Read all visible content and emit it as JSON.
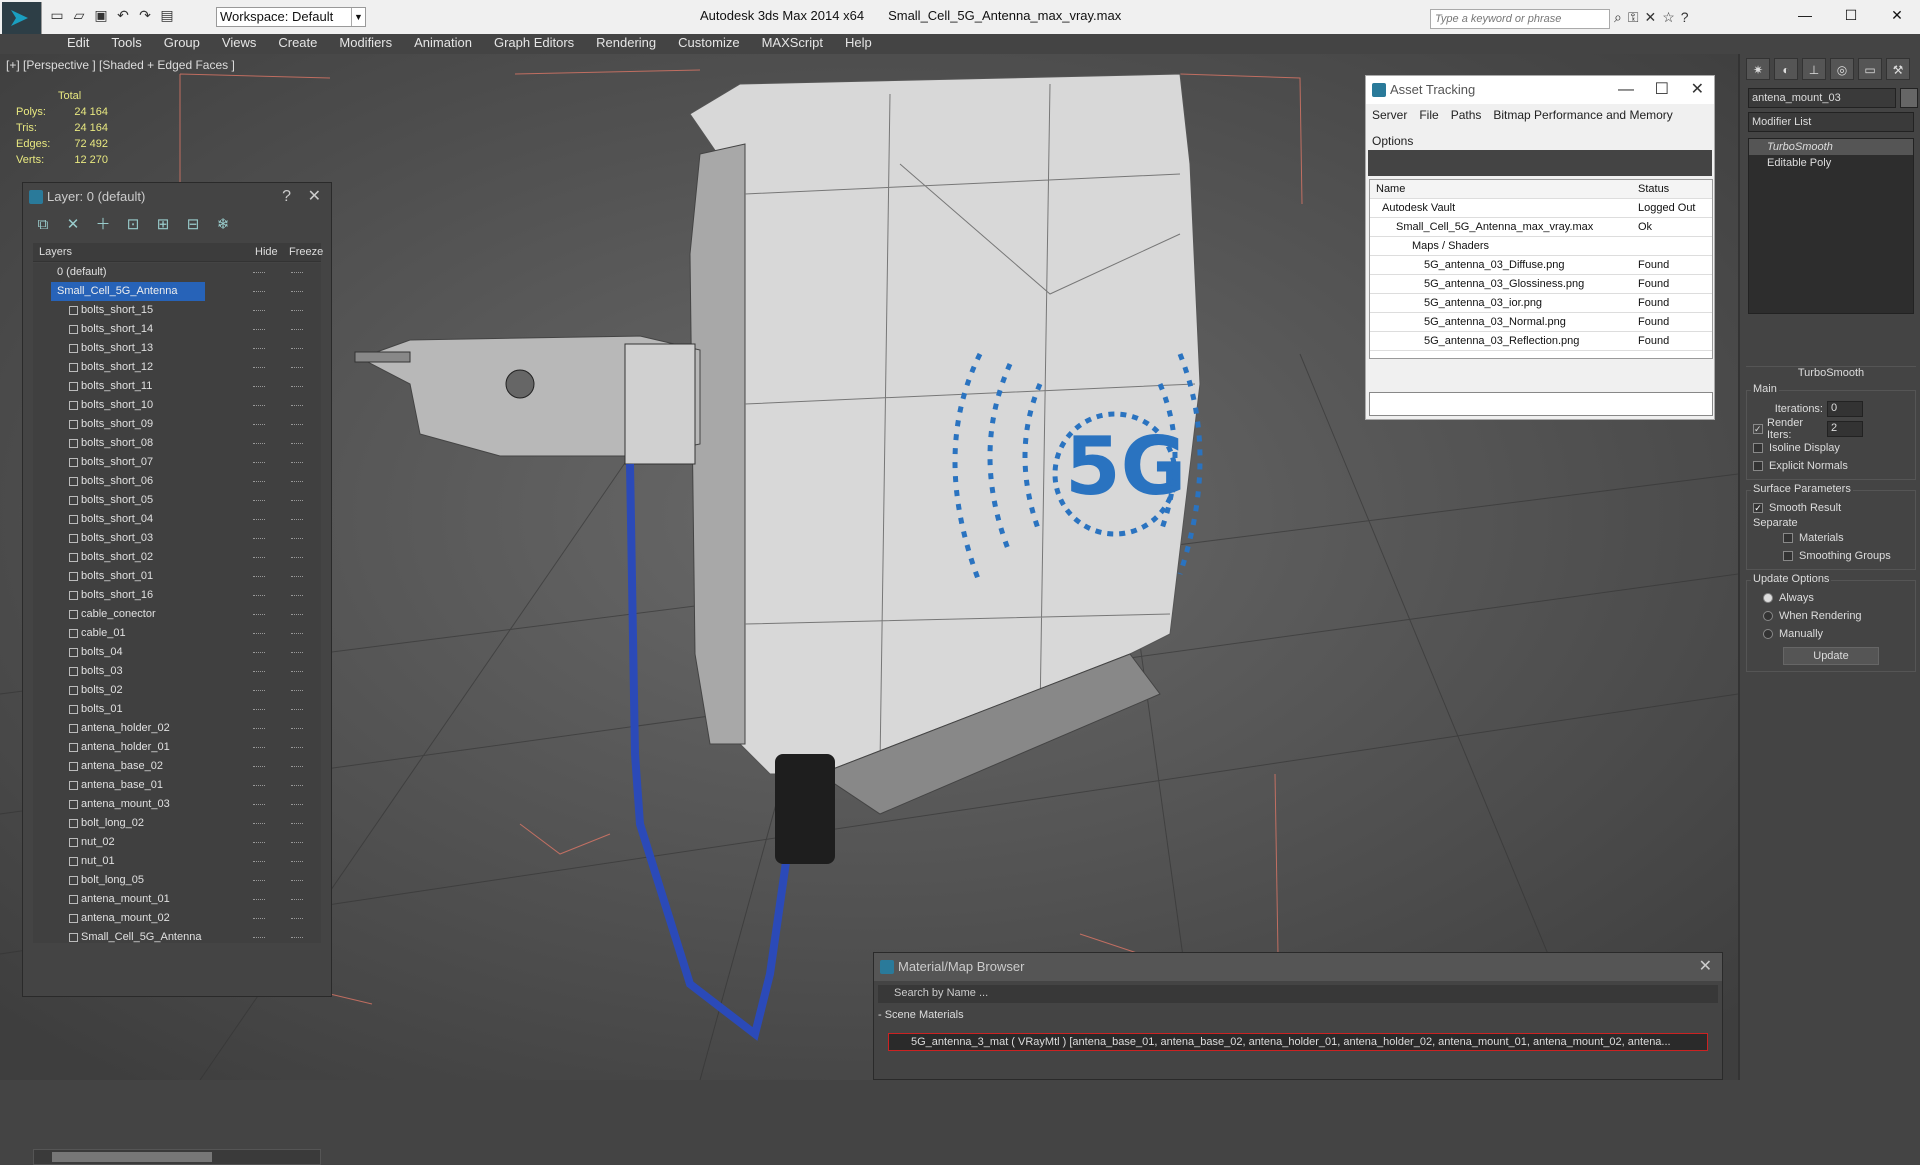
{
  "app": {
    "title": "Autodesk 3ds Max  2014 x64",
    "file": "Small_Cell_5G_Antenna_max_vray.max",
    "workspace": "Workspace: Default",
    "search_placeholder": "Type a keyword or phrase"
  },
  "menu": [
    "Edit",
    "Tools",
    "Group",
    "Views",
    "Create",
    "Modifiers",
    "Animation",
    "Graph Editors",
    "Rendering",
    "Customize",
    "MAXScript",
    "Help"
  ],
  "viewport": {
    "label": "[+] [Perspective ] [Shaded + Edged Faces ]",
    "stats": {
      "header": "Total",
      "rows": [
        {
          "k": "Polys:",
          "v": "24 164"
        },
        {
          "k": "Tris:",
          "v": "24 164"
        },
        {
          "k": "Edges:",
          "v": "72 492"
        },
        {
          "k": "Verts:",
          "v": "12 270"
        }
      ]
    },
    "logo_text": "5G"
  },
  "layer_panel": {
    "title": "Layer: 0 (default)",
    "help": "?",
    "col_layers": "Layers",
    "col_hide": "Hide",
    "col_freeze": "Freeze",
    "rows": [
      "0 (default)",
      "Small_Cell_5G_Antenna",
      "bolts_short_15",
      "bolts_short_14",
      "bolts_short_13",
      "bolts_short_12",
      "bolts_short_11",
      "bolts_short_10",
      "bolts_short_09",
      "bolts_short_08",
      "bolts_short_07",
      "bolts_short_06",
      "bolts_short_05",
      "bolts_short_04",
      "bolts_short_03",
      "bolts_short_02",
      "bolts_short_01",
      "bolts_short_16",
      "cable_conector",
      "cable_01",
      "bolts_04",
      "bolts_03",
      "bolts_02",
      "bolts_01",
      "antena_holder_02",
      "antena_holder_01",
      "antena_base_02",
      "antena_base_01",
      "antena_mount_03",
      "bolt_long_02",
      "nut_02",
      "nut_01",
      "bolt_long_05",
      "antena_mount_01",
      "antena_mount_02",
      "Small_Cell_5G_Antenna"
    ]
  },
  "asset_tracking": {
    "title": "Asset Tracking",
    "menu": [
      "Server",
      "File",
      "Paths",
      "Bitmap Performance and Memory",
      "Options"
    ],
    "col_name": "Name",
    "col_status": "Status",
    "rows": [
      {
        "n": "Autodesk Vault",
        "s": "Logged Out",
        "indent": 30
      },
      {
        "n": "Small_Cell_5G_Antenna_max_vray.max",
        "s": "Ok",
        "indent": 44
      },
      {
        "n": "Maps / Shaders",
        "s": "",
        "indent": 60
      },
      {
        "n": "5G_antenna_03_Diffuse.png",
        "s": "Found",
        "indent": 72
      },
      {
        "n": "5G_antenna_03_Glossiness.png",
        "s": "Found",
        "indent": 72
      },
      {
        "n": "5G_antenna_03_ior.png",
        "s": "Found",
        "indent": 72
      },
      {
        "n": "5G_antenna_03_Normal.png",
        "s": "Found",
        "indent": 72
      },
      {
        "n": "5G_antenna_03_Reflection.png",
        "s": "Found",
        "indent": 72
      }
    ]
  },
  "command_panel": {
    "object_name": "antena_mount_03",
    "modifier_list": "Modifier List",
    "stack": [
      "TurboSmooth",
      "Editable Poly"
    ],
    "turbosmooth": {
      "title": "TurboSmooth",
      "main": "Main",
      "iterations_label": "Iterations:",
      "iterations": "0",
      "render_iters_label": "Render Iters:",
      "render_iters": "2",
      "isoline": "Isoline Display",
      "explicit_normals": "Explicit Normals",
      "surface_params": "Surface Parameters",
      "smooth_result": "Smooth Result",
      "separate": "Separate",
      "materials": "Materials",
      "smoothing_groups": "Smoothing Groups",
      "update_options": "Update Options",
      "always": "Always",
      "when_rendering": "When Rendering",
      "manually": "Manually",
      "update_btn": "Update"
    }
  },
  "material_browser": {
    "title": "Material/Map Browser",
    "search": "Search by Name ...",
    "section": "- Scene Materials",
    "item": "5G_antenna_3_mat  ( VRayMtl )  [antena_base_01, antena_base_02, antena_holder_01, antena_holder_02, antena_mount_01, antena_mount_02, antena..."
  }
}
